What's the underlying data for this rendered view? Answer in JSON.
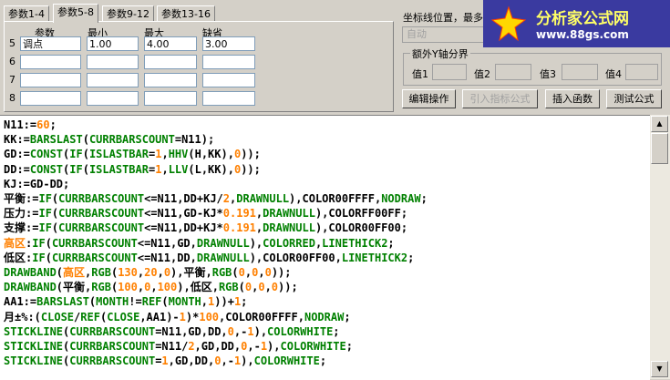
{
  "tabs": [
    "参数1-4",
    "参数5-8",
    "参数9-12",
    "参数13-16"
  ],
  "params": {
    "headers": [
      "参数",
      "最小",
      "最大",
      "缺省"
    ],
    "rows": [
      {
        "num": "5",
        "name": "调点",
        "min": "1.00",
        "max": "4.00",
        "def": "3.00"
      },
      {
        "num": "6",
        "name": "",
        "min": "",
        "max": "",
        "def": ""
      },
      {
        "num": "7",
        "name": "",
        "min": "",
        "max": "",
        "def": ""
      },
      {
        "num": "8",
        "name": "",
        "min": "",
        "max": "",
        "def": ""
      }
    ]
  },
  "right": {
    "axis_label": "坐标线位置，最多",
    "auto_value": "自动",
    "yaxis_group": "额外Y轴分界",
    "vals": [
      "值1",
      "值2",
      "值3",
      "值4"
    ]
  },
  "buttons": {
    "edit": "编辑操作",
    "import": "引入指标公式",
    "insert": "插入函数",
    "test": "测试公式"
  },
  "banner": {
    "title": "分析家公式网",
    "url": "www.88gs.com"
  },
  "code": [
    [
      [
        "N11:=",
        "k"
      ],
      [
        "60",
        "o"
      ],
      [
        ";",
        "k"
      ]
    ],
    [
      [
        "KK:=",
        "k"
      ],
      [
        "BARSLAST",
        "g"
      ],
      [
        "(",
        "k"
      ],
      [
        "CURRBARSCOUNT",
        "g"
      ],
      [
        "=N11);",
        "k"
      ]
    ],
    [
      [
        "GD:=",
        "k"
      ],
      [
        "CONST",
        "g"
      ],
      [
        "(",
        "k"
      ],
      [
        "IF",
        "g"
      ],
      [
        "(",
        "k"
      ],
      [
        "ISLASTBAR",
        "g"
      ],
      [
        "=",
        "k"
      ],
      [
        "1",
        "o"
      ],
      [
        ",",
        "k"
      ],
      [
        "HHV",
        "g"
      ],
      [
        "(H,KK),",
        "k"
      ],
      [
        "0",
        "o"
      ],
      [
        "));",
        "k"
      ]
    ],
    [
      [
        "DD:=",
        "k"
      ],
      [
        "CONST",
        "g"
      ],
      [
        "(",
        "k"
      ],
      [
        "IF",
        "g"
      ],
      [
        "(",
        "k"
      ],
      [
        "ISLASTBAR",
        "g"
      ],
      [
        "=",
        "k"
      ],
      [
        "1",
        "o"
      ],
      [
        ",",
        "k"
      ],
      [
        "LLV",
        "g"
      ],
      [
        "(L,KK),",
        "k"
      ],
      [
        "0",
        "o"
      ],
      [
        "));",
        "k"
      ]
    ],
    [
      [
        "KJ:=GD-DD;",
        "k"
      ]
    ],
    [
      [
        "平衡",
        "k"
      ],
      [
        ":=",
        "k"
      ],
      [
        "IF",
        "g"
      ],
      [
        "(",
        "k"
      ],
      [
        "CURRBARSCOUNT",
        "g"
      ],
      [
        "<=N11,DD+KJ/",
        "k"
      ],
      [
        "2",
        "o"
      ],
      [
        ",",
        "k"
      ],
      [
        "DRAWNULL",
        "g"
      ],
      [
        "),COLOR00FFFF,",
        "k"
      ],
      [
        "NODRAW",
        "g"
      ],
      [
        ";",
        "k"
      ]
    ],
    [
      [
        "压力",
        "k"
      ],
      [
        ":=",
        "k"
      ],
      [
        "IF",
        "g"
      ],
      [
        "(",
        "k"
      ],
      [
        "CURRBARSCOUNT",
        "g"
      ],
      [
        "<=N11,GD-KJ*",
        "k"
      ],
      [
        "0.191",
        "o"
      ],
      [
        ",",
        "k"
      ],
      [
        "DRAWNULL",
        "g"
      ],
      [
        "),COLORFF00FF;",
        "k"
      ]
    ],
    [
      [
        "支撑",
        "k"
      ],
      [
        ":=",
        "k"
      ],
      [
        "IF",
        "g"
      ],
      [
        "(",
        "k"
      ],
      [
        "CURRBARSCOUNT",
        "g"
      ],
      [
        "<=N11,DD+KJ*",
        "k"
      ],
      [
        "0.191",
        "o"
      ],
      [
        ",",
        "k"
      ],
      [
        "DRAWNULL",
        "g"
      ],
      [
        "),COLOR00FF00;",
        "k"
      ]
    ],
    [
      [
        "高区",
        "o"
      ],
      [
        ":",
        "k"
      ],
      [
        "IF",
        "g"
      ],
      [
        "(",
        "k"
      ],
      [
        "CURRBARSCOUNT",
        "g"
      ],
      [
        "<=N11,GD,",
        "k"
      ],
      [
        "DRAWNULL",
        "g"
      ],
      [
        "),",
        "k"
      ],
      [
        "COLORRED",
        "g"
      ],
      [
        ",",
        "k"
      ],
      [
        "LINETHICK2",
        "g"
      ],
      [
        ";",
        "k"
      ]
    ],
    [
      [
        "低区",
        "k"
      ],
      [
        ":",
        "k"
      ],
      [
        "IF",
        "g"
      ],
      [
        "(",
        "k"
      ],
      [
        "CURRBARSCOUNT",
        "g"
      ],
      [
        "<=N11,DD,",
        "k"
      ],
      [
        "DRAWNULL",
        "g"
      ],
      [
        "),COLOR00FF00,",
        "k"
      ],
      [
        "LINETHICK2",
        "g"
      ],
      [
        ";",
        "k"
      ]
    ],
    [
      [
        "DRAWBAND",
        "g"
      ],
      [
        "(",
        "k"
      ],
      [
        "高区",
        "o"
      ],
      [
        ",",
        "k"
      ],
      [
        "RGB",
        "g"
      ],
      [
        "(",
        "k"
      ],
      [
        "130",
        "o"
      ],
      [
        ",",
        "k"
      ],
      [
        "20",
        "o"
      ],
      [
        ",",
        "k"
      ],
      [
        "0",
        "o"
      ],
      [
        "),平衡,",
        "k"
      ],
      [
        "RGB",
        "g"
      ],
      [
        "(",
        "k"
      ],
      [
        "0",
        "o"
      ],
      [
        ",",
        "k"
      ],
      [
        "0",
        "o"
      ],
      [
        ",",
        "k"
      ],
      [
        "0",
        "o"
      ],
      [
        "));",
        "k"
      ]
    ],
    [
      [
        "DRAWBAND",
        "g"
      ],
      [
        "(平衡,",
        "k"
      ],
      [
        "RGB",
        "g"
      ],
      [
        "(",
        "k"
      ],
      [
        "100",
        "o"
      ],
      [
        ",",
        "k"
      ],
      [
        "0",
        "o"
      ],
      [
        ",",
        "k"
      ],
      [
        "100",
        "o"
      ],
      [
        "),低区,",
        "k"
      ],
      [
        "RGB",
        "g"
      ],
      [
        "(",
        "k"
      ],
      [
        "0",
        "o"
      ],
      [
        ",",
        "k"
      ],
      [
        "0",
        "o"
      ],
      [
        ",",
        "k"
      ],
      [
        "0",
        "o"
      ],
      [
        "));",
        "k"
      ]
    ],
    [
      [
        "AA1:=",
        "k"
      ],
      [
        "BARSLAST",
        "g"
      ],
      [
        "(",
        "k"
      ],
      [
        "MONTH",
        "g"
      ],
      [
        "!=",
        "k"
      ],
      [
        "REF",
        "g"
      ],
      [
        "(",
        "k"
      ],
      [
        "MONTH",
        "g"
      ],
      [
        ",",
        "k"
      ],
      [
        "1",
        "o"
      ],
      [
        "))+",
        "k"
      ],
      [
        "1",
        "o"
      ],
      [
        ";",
        "k"
      ]
    ],
    [
      [
        "月±%:(",
        "k"
      ],
      [
        "CLOSE",
        "g"
      ],
      [
        "/",
        "k"
      ],
      [
        "REF",
        "g"
      ],
      [
        "(",
        "k"
      ],
      [
        "CLOSE",
        "g"
      ],
      [
        ",AA1)-",
        "k"
      ],
      [
        "1",
        "o"
      ],
      [
        ")*",
        "k"
      ],
      [
        "100",
        "o"
      ],
      [
        ",COLOR00FFFF,",
        "k"
      ],
      [
        "NODRAW",
        "g"
      ],
      [
        ";",
        "k"
      ]
    ],
    [
      [
        "STICKLINE",
        "g"
      ],
      [
        "(",
        "k"
      ],
      [
        "CURRBARSCOUNT",
        "g"
      ],
      [
        "=N11,GD,DD,",
        "k"
      ],
      [
        "0",
        "o"
      ],
      [
        ",-",
        "k"
      ],
      [
        "1",
        "o"
      ],
      [
        "),",
        "k"
      ],
      [
        "COLORWHITE",
        "g"
      ],
      [
        ";",
        "k"
      ]
    ],
    [
      [
        "STICKLINE",
        "g"
      ],
      [
        "(",
        "k"
      ],
      [
        "CURRBARSCOUNT",
        "g"
      ],
      [
        "=N11/",
        "k"
      ],
      [
        "2",
        "o"
      ],
      [
        ",GD,DD,",
        "k"
      ],
      [
        "0",
        "o"
      ],
      [
        ",-",
        "k"
      ],
      [
        "1",
        "o"
      ],
      [
        "),",
        "k"
      ],
      [
        "COLORWHITE",
        "g"
      ],
      [
        ";",
        "k"
      ]
    ],
    [
      [
        "STICKLINE",
        "g"
      ],
      [
        "(",
        "k"
      ],
      [
        "CURRBARSCOUNT",
        "g"
      ],
      [
        "=",
        "k"
      ],
      [
        "1",
        "o"
      ],
      [
        ",GD,DD,",
        "k"
      ],
      [
        "0",
        "o"
      ],
      [
        ",-",
        "k"
      ],
      [
        "1",
        "o"
      ],
      [
        "),",
        "k"
      ],
      [
        "COLORWHITE",
        "g"
      ],
      [
        ";",
        "k"
      ]
    ]
  ],
  "colors": {
    "k": "#000000",
    "g": "#008000",
    "o": "#ff8000",
    "banner": "#3a3aa0"
  }
}
